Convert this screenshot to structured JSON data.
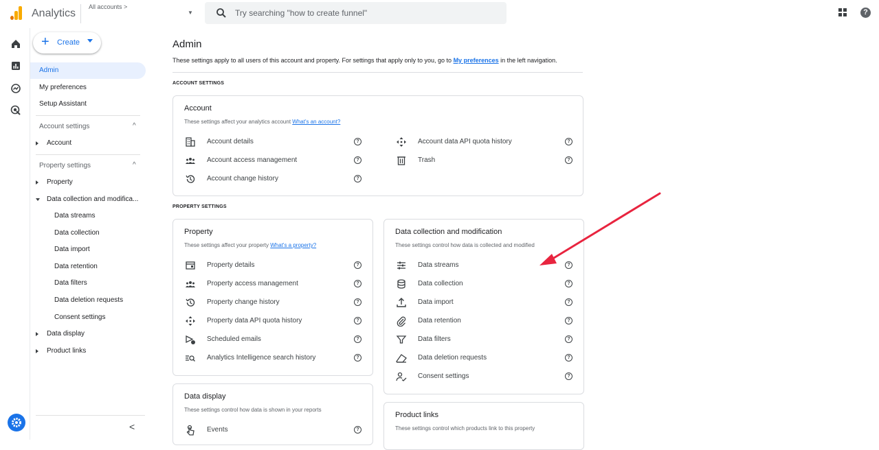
{
  "header": {
    "app_title": "Analytics",
    "all_accounts": "All accounts",
    "all_accounts_chevron": ">",
    "search_placeholder": "Try searching \"how to create funnel\"",
    "help_glyph": "?"
  },
  "sidenav": {
    "create_label": "Create",
    "create_glyph": "+",
    "items": {
      "admin": "Admin",
      "my_preferences": "My preferences",
      "setup_assistant": "Setup Assistant"
    },
    "account_settings": {
      "heading": "Account settings",
      "account": "Account"
    },
    "property_settings": {
      "heading": "Property settings",
      "property": "Property",
      "data_collection_mod": "Data collection and modifica...",
      "sub": [
        "Data streams",
        "Data collection",
        "Data import",
        "Data retention",
        "Data filters",
        "Data deletion requests",
        "Consent settings"
      ],
      "data_display": "Data display",
      "product_links": "Product links"
    },
    "chevron_up": "^",
    "collapse_glyph": "<"
  },
  "main": {
    "title": "Admin",
    "desc_before": "These settings apply to all users of this account and property. For settings that apply only to you, go to ",
    "desc_link": "My preferences",
    "desc_after": " in the left navigation.",
    "account_settings_label": "ACCOUNT SETTINGS",
    "property_settings_label": "PROPERTY SETTINGS",
    "account_card": {
      "title": "Account",
      "desc": "These settings affect your analytics account ",
      "desc_link": "What's an account?",
      "left": [
        "Account details",
        "Account access management",
        "Account change history"
      ],
      "right": [
        "Account data API quota history",
        "Trash"
      ]
    },
    "property_card": {
      "title": "Property",
      "desc": "These settings affect your property ",
      "desc_link": "What's a property?",
      "items": [
        "Property details",
        "Property access management",
        "Property change history",
        "Property data API quota history",
        "Scheduled emails",
        "Analytics Intelligence search history"
      ]
    },
    "dcm_card": {
      "title": "Data collection and modification",
      "desc": "These settings control how data is collected and modified",
      "items": [
        "Data streams",
        "Data collection",
        "Data import",
        "Data retention",
        "Data filters",
        "Data deletion requests",
        "Consent settings"
      ]
    },
    "display_card": {
      "title": "Data display",
      "desc": "These settings control how data is shown in your reports",
      "items": [
        "Events"
      ]
    },
    "links_card": {
      "title": "Product links",
      "desc": "These settings control which products link to this property"
    },
    "help_glyph": "?"
  },
  "colors": {
    "accent": "#1a73e8",
    "selected_bg": "#e8f0fe",
    "annotation_arrow": "#e8243f",
    "logo_orange": "#f9ab00",
    "logo_dark_orange": "#e37400"
  }
}
